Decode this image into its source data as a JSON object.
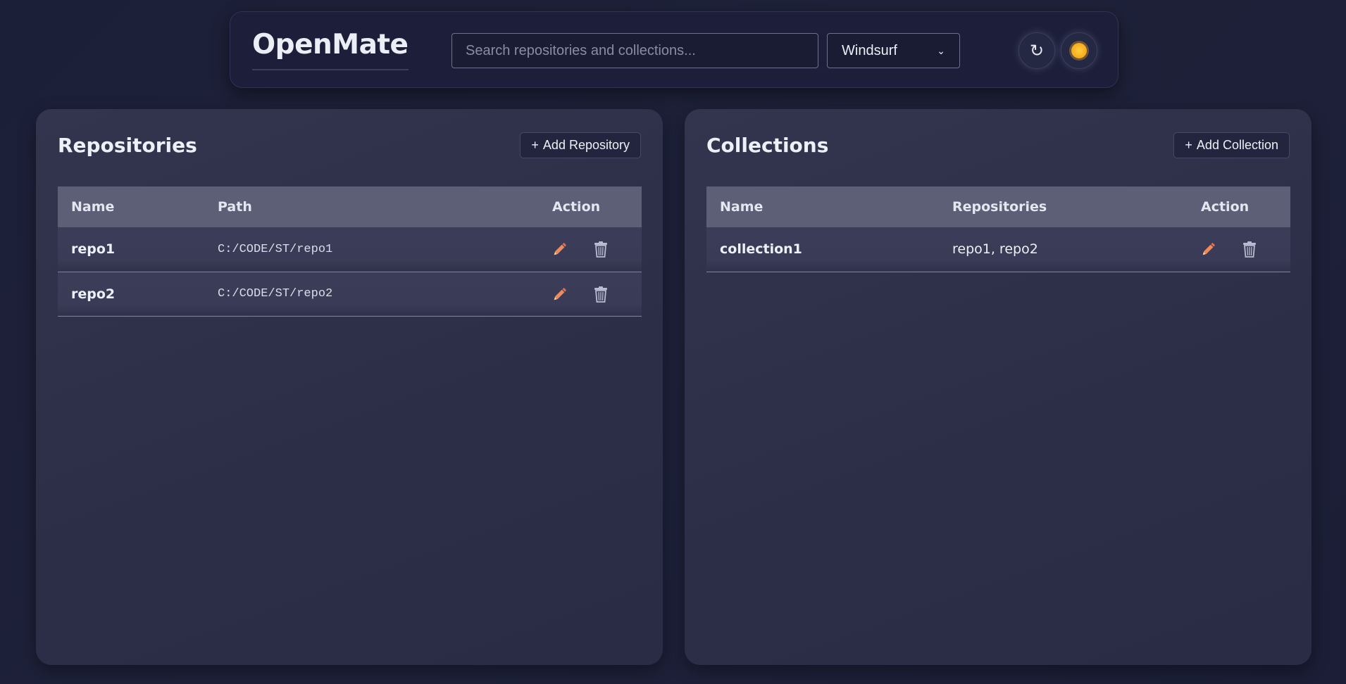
{
  "app": {
    "title": "OpenMate"
  },
  "header": {
    "search_placeholder": "Search repositories and collections...",
    "search_value": "",
    "editor_select": "Windsurf",
    "refresh_glyph": "↻",
    "refresh_icon": "refresh-icon",
    "theme_icon": "sun-icon"
  },
  "repositories": {
    "title": "Repositories",
    "add_label": "Add Repository",
    "add_prefix": "+",
    "columns": {
      "name": "Name",
      "path": "Path",
      "action": "Action"
    },
    "rows": [
      {
        "name": "repo1",
        "path": "C:/CODE/ST/repo1"
      },
      {
        "name": "repo2",
        "path": "C:/CODE/ST/repo2"
      }
    ]
  },
  "collections": {
    "title": "Collections",
    "add_label": "Add Collection",
    "add_prefix": "+",
    "columns": {
      "name": "Name",
      "repositories": "Repositories",
      "action": "Action"
    },
    "rows": [
      {
        "name": "collection1",
        "repositories": "repo1, repo2"
      }
    ]
  },
  "colors": {
    "background": "#1c1f38",
    "panel": "#2f3149",
    "header_row": "#5d5f76",
    "edit_icon": "#f08a5d",
    "delete_icon": "#b9bbd0",
    "theme_sun": "#f7a81d"
  }
}
